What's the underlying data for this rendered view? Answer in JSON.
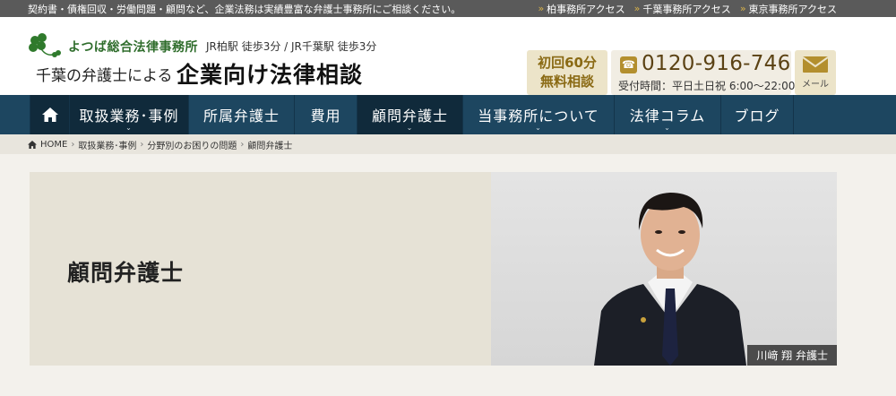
{
  "topbar": {
    "notice": "契約書・債権回収・労働問題・顧問など、企業法務は実績豊富な弁護士事務所にご相談ください。",
    "links": [
      {
        "label": "柏事務所アクセス"
      },
      {
        "label": "千葉事務所アクセス"
      },
      {
        "label": "東京事務所アクセス"
      }
    ]
  },
  "header": {
    "firm_name": "よつば総合法律事務所",
    "stations": "JR柏駅 徒歩3分 / JR千葉駅 徒歩3分",
    "tagline_small": "千葉の弁護士による",
    "tagline_big": "企業向け法律相談",
    "free_line1": "初回60分",
    "free_line2": "無料相談",
    "phone": "0120-916-746",
    "hours": "受付時間：平日土日祝 6:00～22:00",
    "mail_label": "メール"
  },
  "nav": {
    "items": [
      {
        "label": "取扱業務･事例",
        "has_dropdown": true
      },
      {
        "label": "所属弁護士",
        "has_dropdown": false
      },
      {
        "label": "費用",
        "has_dropdown": false
      },
      {
        "label": "顧問弁護士",
        "has_dropdown": true
      },
      {
        "label": "当事務所について",
        "has_dropdown": true
      },
      {
        "label": "法律コラム",
        "has_dropdown": true
      },
      {
        "label": "ブログ",
        "has_dropdown": false
      }
    ]
  },
  "breadcrumb": [
    {
      "label": "HOME"
    },
    {
      "label": "取扱業務･事例"
    },
    {
      "label": "分野別のお困りの問題"
    },
    {
      "label": "顧問弁護士"
    }
  ],
  "hero": {
    "title": "顧問弁護士",
    "name_tag": "川﨑 翔 弁護士"
  },
  "colors": {
    "nav_bg": "#1d4660",
    "nav_active": "#102a3b",
    "accent_gold": "#b38f2e",
    "brand_green": "#2f6d2c"
  }
}
